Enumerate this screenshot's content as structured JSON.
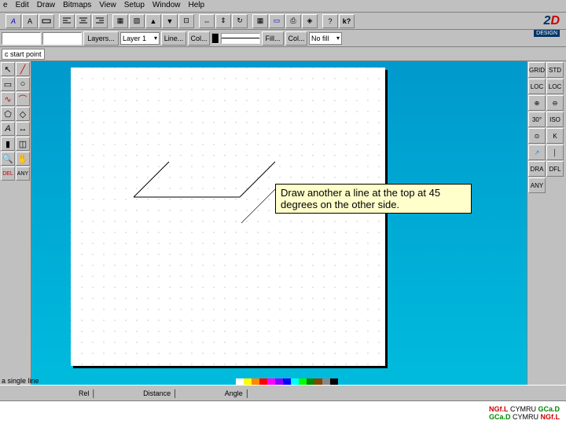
{
  "menu": {
    "items": [
      "e",
      "Edit",
      "Draw",
      "Bitmaps",
      "View",
      "Setup",
      "Window",
      "Help"
    ]
  },
  "toolbar2": {
    "layers_label": "Layers...",
    "layer_value": "Layer 1",
    "line_label": "Line...",
    "col_label": "Col...",
    "fill_label": "Fill...",
    "fillcol_label": "Col...",
    "nofill_label": "No fill"
  },
  "toolbar3": {
    "startpoint": "c start point"
  },
  "logo": {
    "text2": "2",
    "textD": "D",
    "design": "DESIGN"
  },
  "right": {
    "grid": "GRID",
    "std": "STD",
    "loc": "LOC",
    "loc2": "LOC",
    "thirty": "30°",
    "iso": "ISO",
    "k": "K",
    "dra": "DRA",
    "dfl": "DFL",
    "any": "ANY"
  },
  "tooltip": {
    "text": "Draw another a line at the top at 45 degrees on the other side."
  },
  "status": {
    "rel": "Rel",
    "distance": "Distance",
    "angle": "Angle"
  },
  "statusline": "a single line",
  "footer": {
    "l1a": "NGf.L",
    "l1b": "CYMRU",
    "l1c": "GCa.D",
    "l2a": "GCa.D",
    "l2b": "CYMRU",
    "l2c": "NGf.L"
  }
}
